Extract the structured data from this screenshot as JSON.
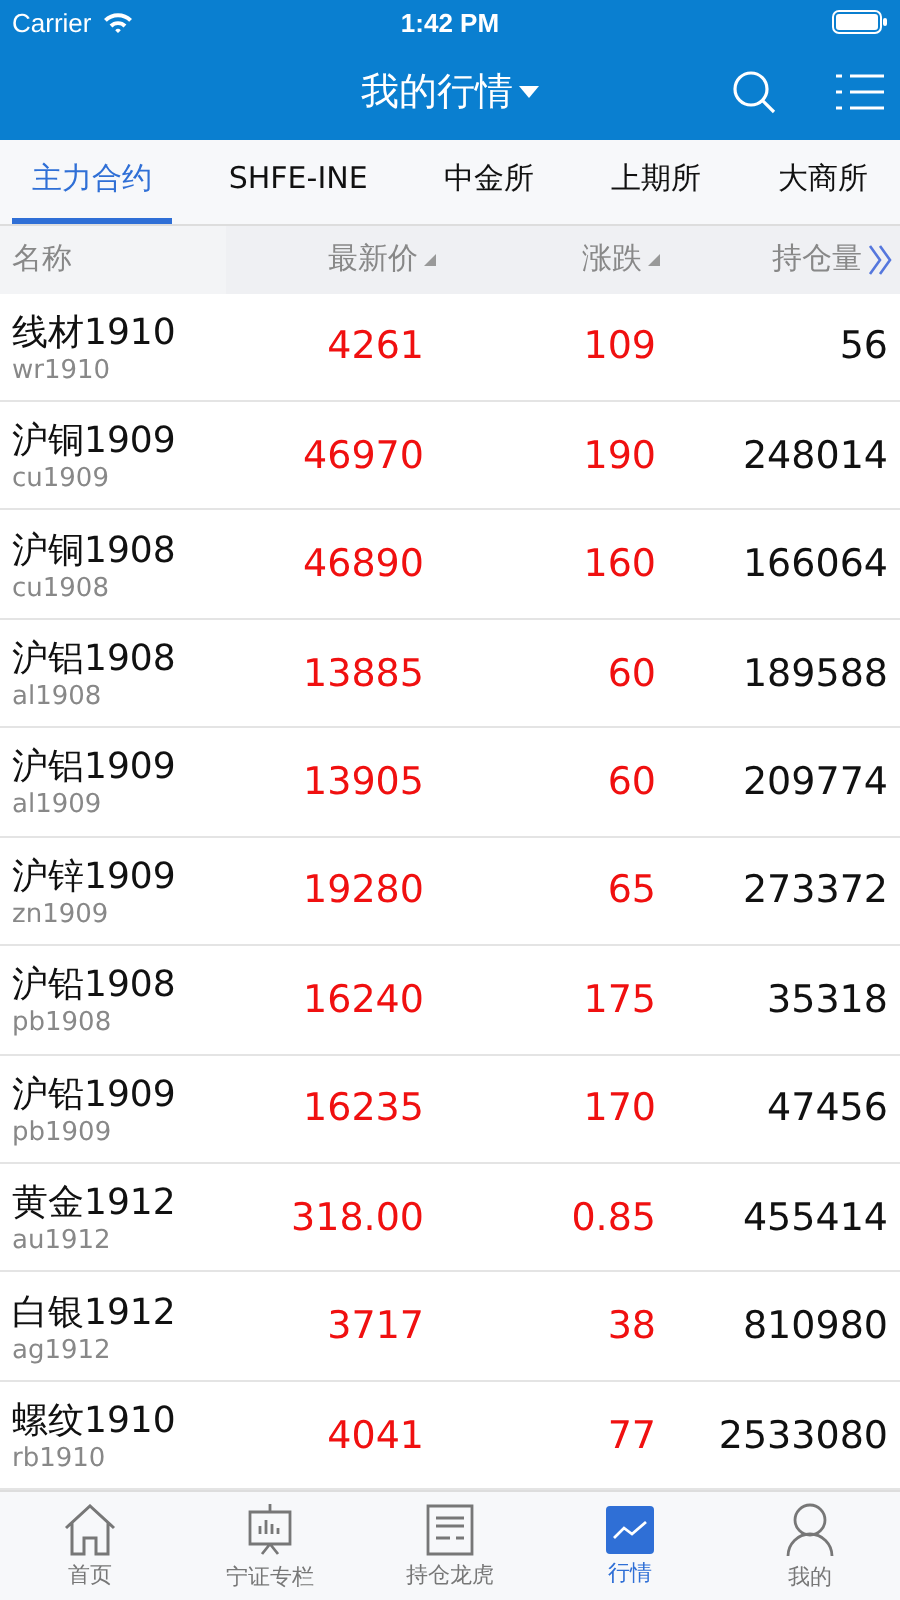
{
  "status_bar": {
    "carrier": "Carrier",
    "time": "1:42 PM"
  },
  "nav": {
    "title": "我的行情"
  },
  "tabs": [
    {
      "label": "主力合约",
      "selected": true
    },
    {
      "label": "SHFE-INE",
      "selected": false
    },
    {
      "label": "中金所",
      "selected": false
    },
    {
      "label": "上期所",
      "selected": false
    },
    {
      "label": "大商所",
      "selected": false
    }
  ],
  "table": {
    "columns": [
      {
        "label": "名称",
        "kind": "plain"
      },
      {
        "label": "最新价",
        "kind": "sort"
      },
      {
        "label": "涨跌",
        "kind": "sort"
      },
      {
        "label": "持仓量",
        "kind": "more"
      }
    ],
    "rows": [
      {
        "name": "线材1910",
        "code": "wr1910",
        "price": "4261",
        "change": "109",
        "open_interest": "56",
        "rising": true
      },
      {
        "name": "沪铜1909",
        "code": "cu1909",
        "price": "46970",
        "change": "190",
        "open_interest": "248014",
        "rising": true
      },
      {
        "name": "沪铜1908",
        "code": "cu1908",
        "price": "46890",
        "change": "160",
        "open_interest": "166064",
        "rising": true
      },
      {
        "name": "沪铝1908",
        "code": "al1908",
        "price": "13885",
        "change": "60",
        "open_interest": "189588",
        "rising": true
      },
      {
        "name": "沪铝1909",
        "code": "al1909",
        "price": "13905",
        "change": "60",
        "open_interest": "209774",
        "rising": true
      },
      {
        "name": "沪锌1909",
        "code": "zn1909",
        "price": "19280",
        "change": "65",
        "open_interest": "273372",
        "rising": true
      },
      {
        "name": "沪铅1908",
        "code": "pb1908",
        "price": "16240",
        "change": "175",
        "open_interest": "35318",
        "rising": true
      },
      {
        "name": "沪铅1909",
        "code": "pb1909",
        "price": "16235",
        "change": "170",
        "open_interest": "47456",
        "rising": true
      },
      {
        "name": "黄金1912",
        "code": "au1912",
        "price": "318.00",
        "change": "0.85",
        "open_interest": "455414",
        "rising": true
      },
      {
        "name": "白银1912",
        "code": "ag1912",
        "price": "3717",
        "change": "38",
        "open_interest": "810980",
        "rising": true
      },
      {
        "name": "螺纹1910",
        "code": "rb1910",
        "price": "4041",
        "change": "77",
        "open_interest": "2533080",
        "rising": true
      }
    ]
  },
  "tab_bar": [
    {
      "label": "首页",
      "kind": "home",
      "selected": false
    },
    {
      "label": "宁证专栏",
      "kind": "column",
      "selected": false
    },
    {
      "label": "持仓龙虎",
      "kind": "list",
      "selected": false
    },
    {
      "label": "行情",
      "kind": "chart",
      "selected": true
    },
    {
      "label": "我的",
      "kind": "person",
      "selected": false
    }
  ]
}
